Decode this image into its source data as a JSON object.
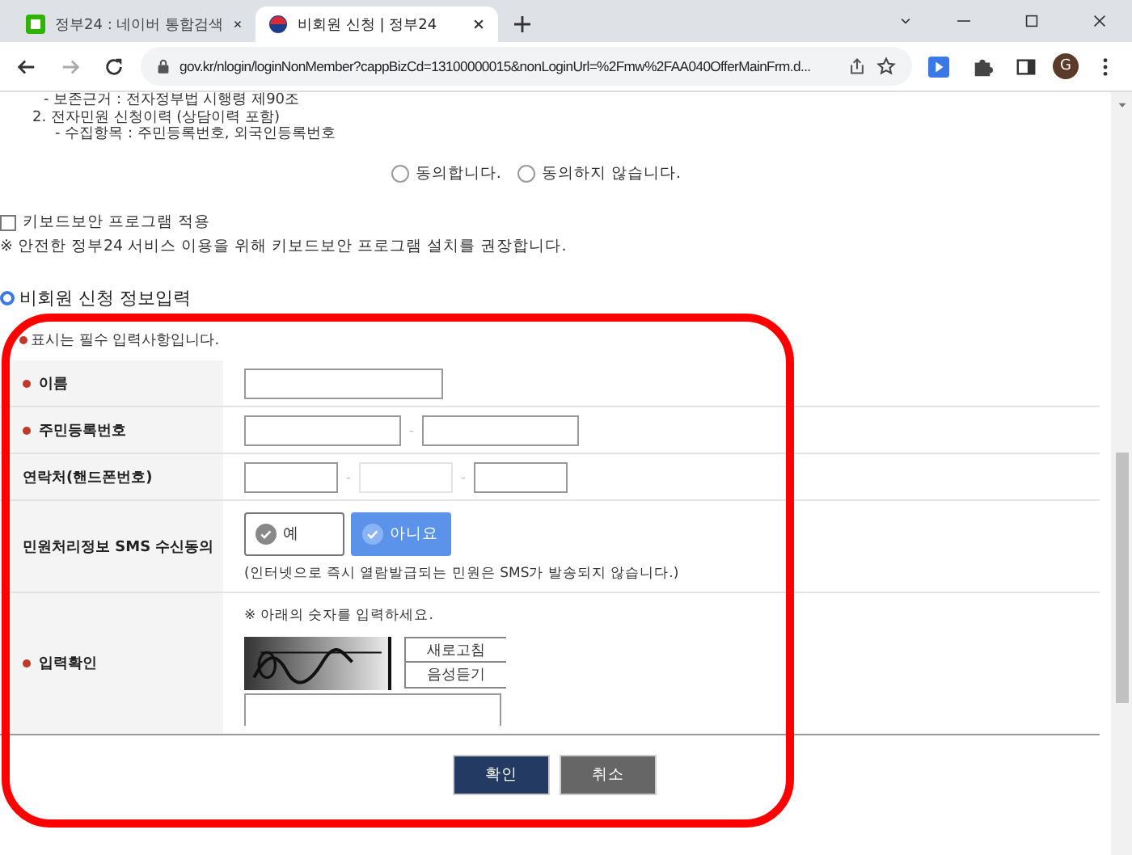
{
  "browser": {
    "tabs": [
      {
        "title": "정부24 : 네이버 통합검색",
        "selected": false
      },
      {
        "title": "비회원 신청 | 정부24",
        "selected": true
      }
    ],
    "url": "gov.kr/nlogin/loginNonMember?cappBizCd=13100000015&nonLoginUrl=%2Fmw%2FAA040OfferMainFrm.d...",
    "profile": "G"
  },
  "terms_lines": [
    "- 보존근거 : 전자정부법 시행령 제90조",
    "2. 전자민원 신청이력 (상담이력 포함)",
    "- 수집항목 : 주민등록번호, 외국인등록번호"
  ],
  "consent": [
    {
      "label": "동의합니다.",
      "selected": false
    },
    {
      "label": "동의하지 않습니다.",
      "selected": false
    }
  ],
  "keyboard_security": {
    "label": "키보드보안 프로그램 적용",
    "checked": false
  },
  "security_notice": "※ 안전한 정부24 서비스 이용을 위해 키보드보안 프로그램 설치를 권장합니다.",
  "section_title": "비회원 신청 정보입력",
  "required_note": "표시는 필수 입력사항입니다.",
  "rows": [
    {
      "label": "이름",
      "required": true,
      "kind": "text"
    },
    {
      "label": "주민등록번호",
      "required": true,
      "kind": "rrn",
      "separator": "-"
    },
    {
      "label": "연락처(핸드폰번호)",
      "required": false,
      "kind": "phone",
      "separator": "-"
    },
    {
      "label": "민원처리정보 SMS 수신동의",
      "required": false,
      "kind": "choice",
      "options": [
        {
          "label": "예",
          "selected": false
        },
        {
          "label": "아니요",
          "selected": true
        }
      ],
      "note": "(인터넷으로 즉시 열람발급되는 민원은 SMS가 발송되지 않습니다.)"
    },
    {
      "label": "입력확인",
      "required": true,
      "kind": "captcha",
      "hint": "※ 아래의 숫자를 입력하세요.",
      "buttons": [
        "새로고침",
        "음성듣기"
      ]
    }
  ],
  "actions": [
    {
      "label": "확인",
      "kind": "primary"
    },
    {
      "label": "취소",
      "kind": "secondary"
    }
  ]
}
